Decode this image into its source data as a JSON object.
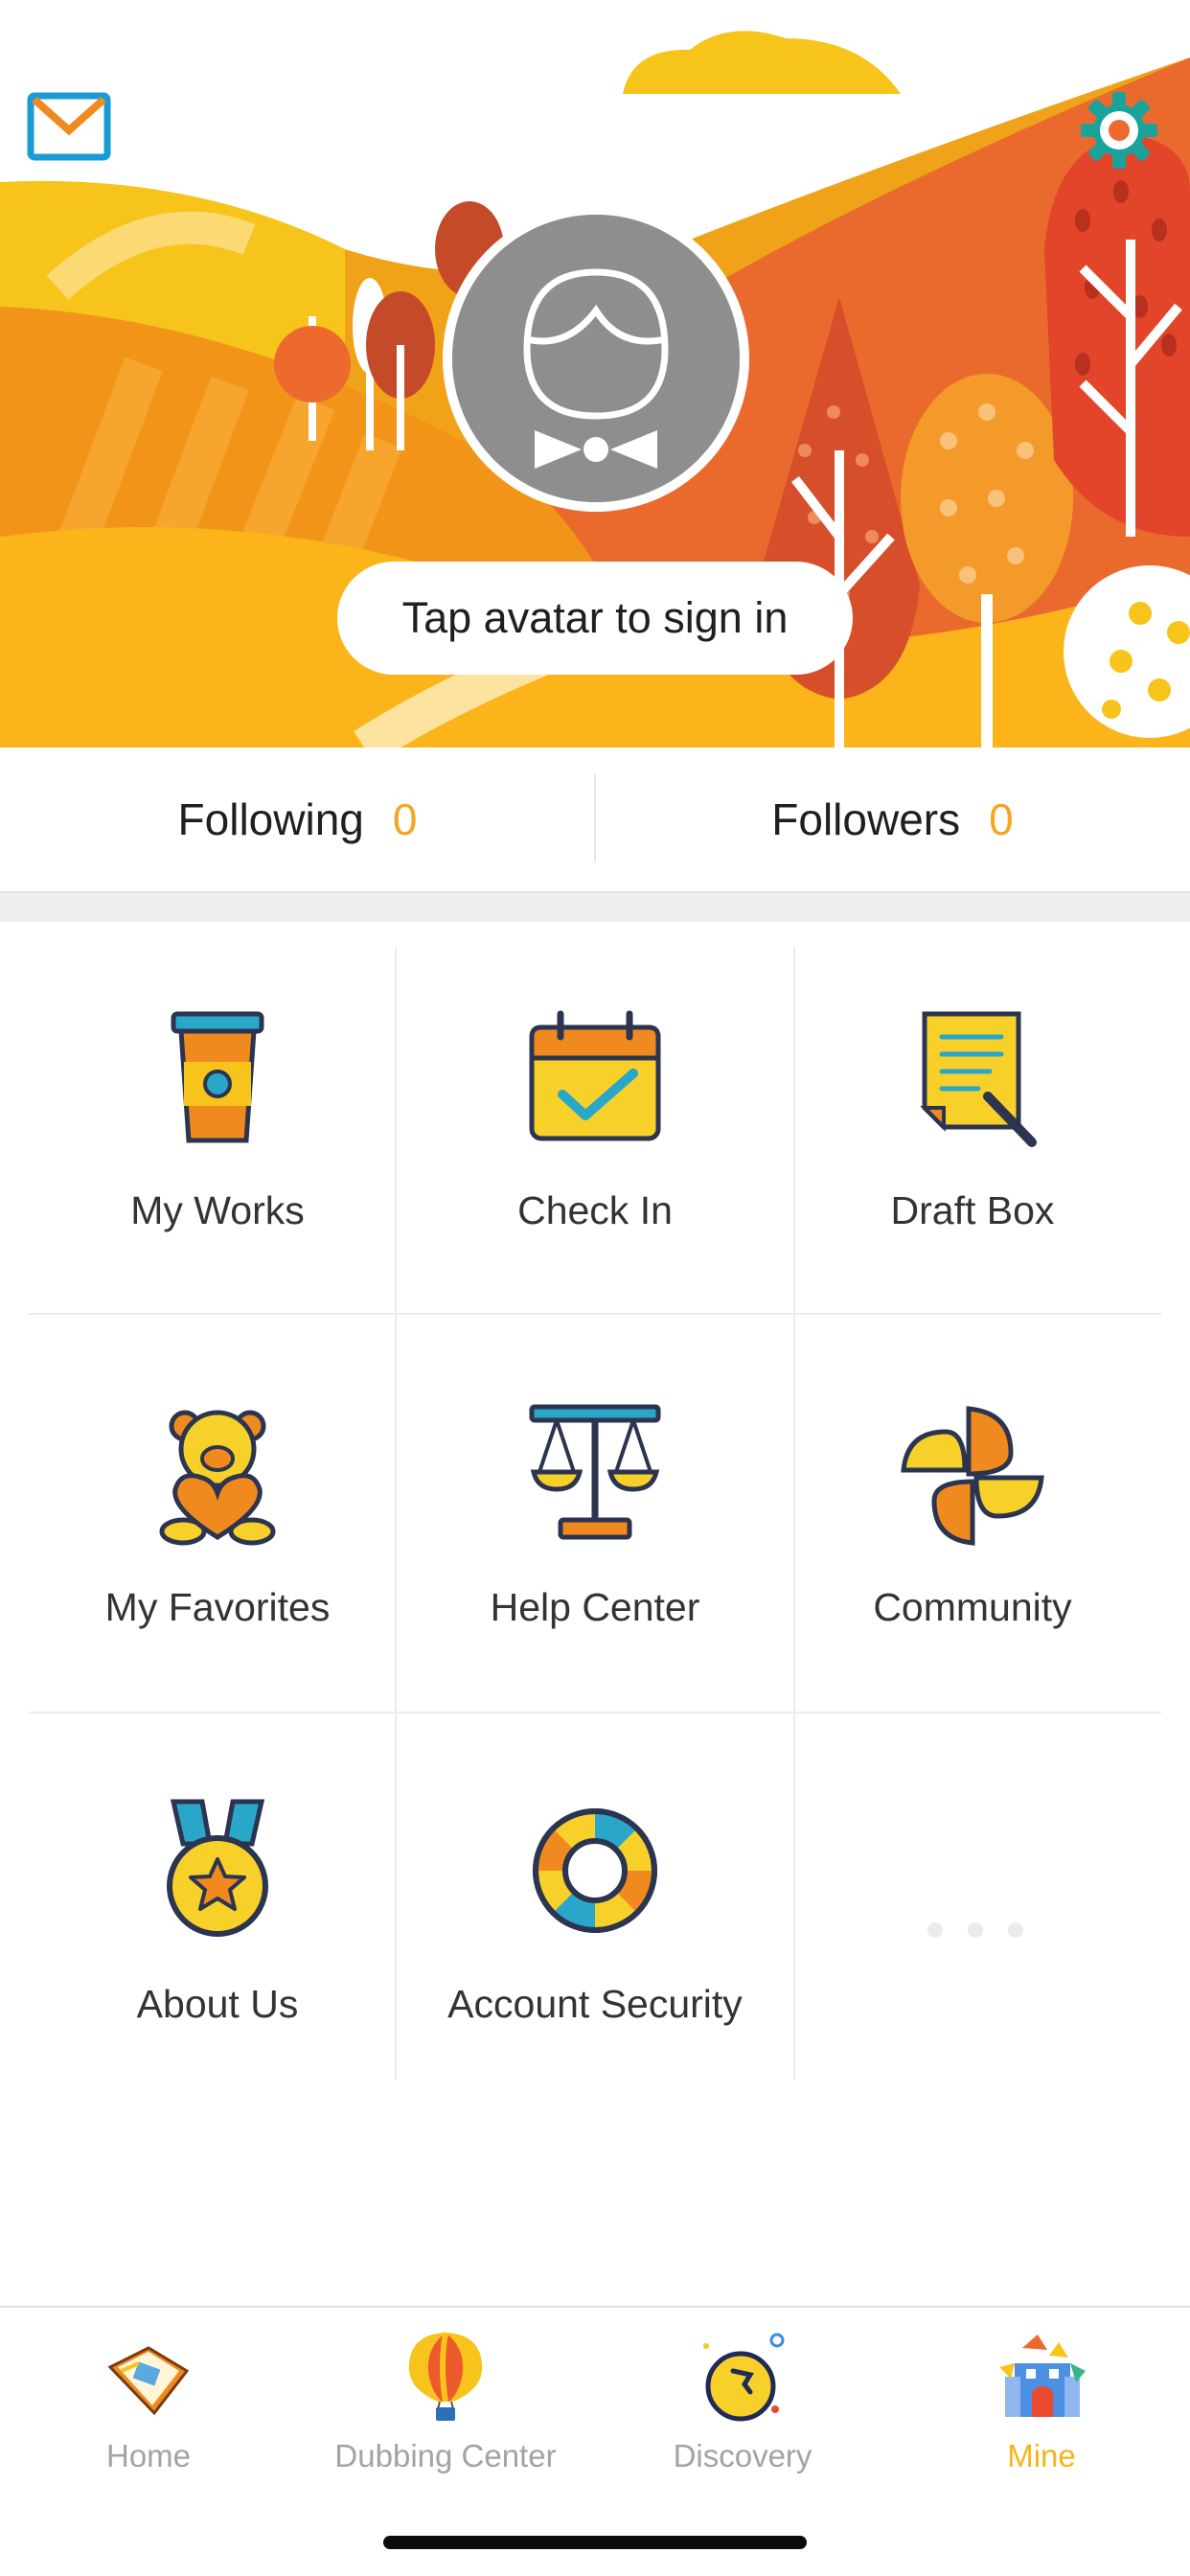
{
  "header": {
    "mail_icon": "mail-icon",
    "settings_icon": "gear-icon",
    "avatar_icon": "avatar-placeholder-icon",
    "sign_in_prompt": "Tap avatar to sign in"
  },
  "stats": {
    "following_label": "Following",
    "following_count": "0",
    "followers_label": "Followers",
    "followers_count": "0"
  },
  "menu": {
    "items": [
      {
        "label": "My Works",
        "icon": "cup-icon"
      },
      {
        "label": "Check In",
        "icon": "calendar-check-icon"
      },
      {
        "label": "Draft Box",
        "icon": "document-pen-icon"
      },
      {
        "label": "My Favorites",
        "icon": "teddy-bear-heart-icon"
      },
      {
        "label": "Help Center",
        "icon": "scales-icon"
      },
      {
        "label": "Community",
        "icon": "pinwheel-icon"
      },
      {
        "label": "About Us",
        "icon": "medal-icon"
      },
      {
        "label": "Account Security",
        "icon": "lifebuoy-icon"
      }
    ],
    "more_icon": "more-dots-icon"
  },
  "tabbar": {
    "tabs": [
      {
        "label": "Home",
        "icon": "book-icon",
        "active": false
      },
      {
        "label": "Dubbing Center",
        "icon": "hot-air-balloon-icon",
        "active": false
      },
      {
        "label": "Discovery",
        "icon": "compass-icon",
        "active": false
      },
      {
        "label": "Mine",
        "icon": "castle-icon",
        "active": true
      }
    ]
  },
  "colors": {
    "accent": "#f5b419",
    "count": "#f5a623",
    "label_inactive": "#a3a3a3"
  }
}
